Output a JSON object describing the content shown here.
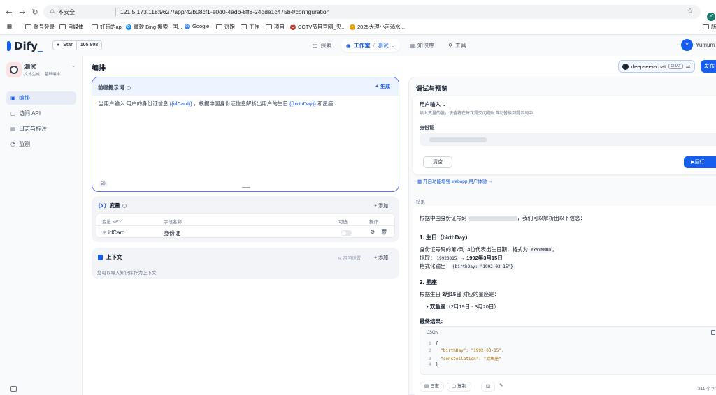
{
  "browser": {
    "insecure_label": "不安全",
    "url": "121.5.173.118:9627/app/42b08cf1-e0d0-4adb-8ff8-24dde1c475b4/configuration",
    "profile_initial": "Y",
    "bookmarks": [
      "账号登录",
      "自媒体",
      "好玩的api",
      "微软 Bing 搜索 - 国...",
      "Google",
      "逃跑",
      "工作",
      "项目",
      "CCTV节目官网_央...",
      "2025大理小河淌水..."
    ],
    "bookmark_right": "所"
  },
  "header": {
    "logo": "Dify",
    "github_label": "Star",
    "github_count": "105,808",
    "nav": {
      "explore": "探索",
      "studio": "工作室",
      "workspace": "测试",
      "knowledge": "知识库",
      "tools": "工具"
    },
    "user_initial": "Y",
    "user_name": "Yumum"
  },
  "sidebar": {
    "app_name": "测试",
    "app_tags": [
      "文本生成",
      "基础编排"
    ],
    "items": [
      {
        "label": "编排",
        "icon": "terminal-icon"
      },
      {
        "label": "访问 API",
        "icon": "api-icon"
      },
      {
        "label": "日志与标注",
        "icon": "log-icon"
      },
      {
        "label": "监测",
        "icon": "monitor-icon"
      }
    ]
  },
  "main": {
    "title": "编排",
    "model": "deepseek-chat",
    "model_tag": "CHAT",
    "publish": "发布"
  },
  "prompt": {
    "title": "前缀提示词",
    "generate": "生成",
    "text_a": "当用户输入 用户的身份证信息 ",
    "var_a": "{{idCard}}",
    "text_b": " ，根据中国身份证信息解析出用户的生日 ",
    "var_b": "{{birthDay}}",
    "text_c": " 和星座",
    "count": "59"
  },
  "variables": {
    "title": "变量",
    "add": "+ 添加",
    "headers": {
      "key": "变量 KEY",
      "name": "字段名称",
      "optional": "可选",
      "actions": "操作"
    },
    "rows": [
      {
        "key": "idCard",
        "name": "身份证"
      }
    ]
  },
  "context": {
    "title": "上下文",
    "settings": "召回设置",
    "add": "+ 添加",
    "desc": "您可以导入知识库作为上下文"
  },
  "preview": {
    "title": "调试与预览",
    "user_input": "用户输入",
    "hint": "填入变量的值，该值将在每次提交问题时自动替换到提示词中",
    "field_label": "身份证",
    "clear": "清空",
    "run": "运行",
    "webapp_link": "开启功能增强 webapp 用户体验",
    "result_label": "结果",
    "result": {
      "intro_a": "根据中国身份证号码 ",
      "intro_b": "，我们可以解析出以下信息：",
      "h1": "1. 生日（birthDay）",
      "p1": "身份证号码的第7到14位代表出生日期，格式为 ",
      "p1_code": "YYYYMMDD",
      "p1_end": "。",
      "extract_a": "提取：",
      "extract_code": "19920315",
      "extract_b": " → ",
      "extract_bold": "1992年3月15日",
      "fmt_a": "格式化输出：",
      "fmt_code": "{birthDay: \"1992-03-15\"}",
      "h2": "2. 星座",
      "p2_a": "根据生日 ",
      "p2_bold": "3月15日",
      "p2_b": " 对应的星座是：",
      "bullet_bold": "双鱼座",
      "bullet_rest": "（2月19日 - 3月20日）",
      "final": "最终结果：",
      "json_label": "JSON",
      "code": [
        "{",
        "  \"birthDay\": \"1992-03-15\",",
        "  \"constellation\": \"双鱼座\"",
        "}"
      ],
      "log": "日志",
      "copy": "复制",
      "char_count": "311 个字符"
    }
  },
  "colors": {
    "accent": "#155eef",
    "prompt_border": "#6172f3"
  }
}
